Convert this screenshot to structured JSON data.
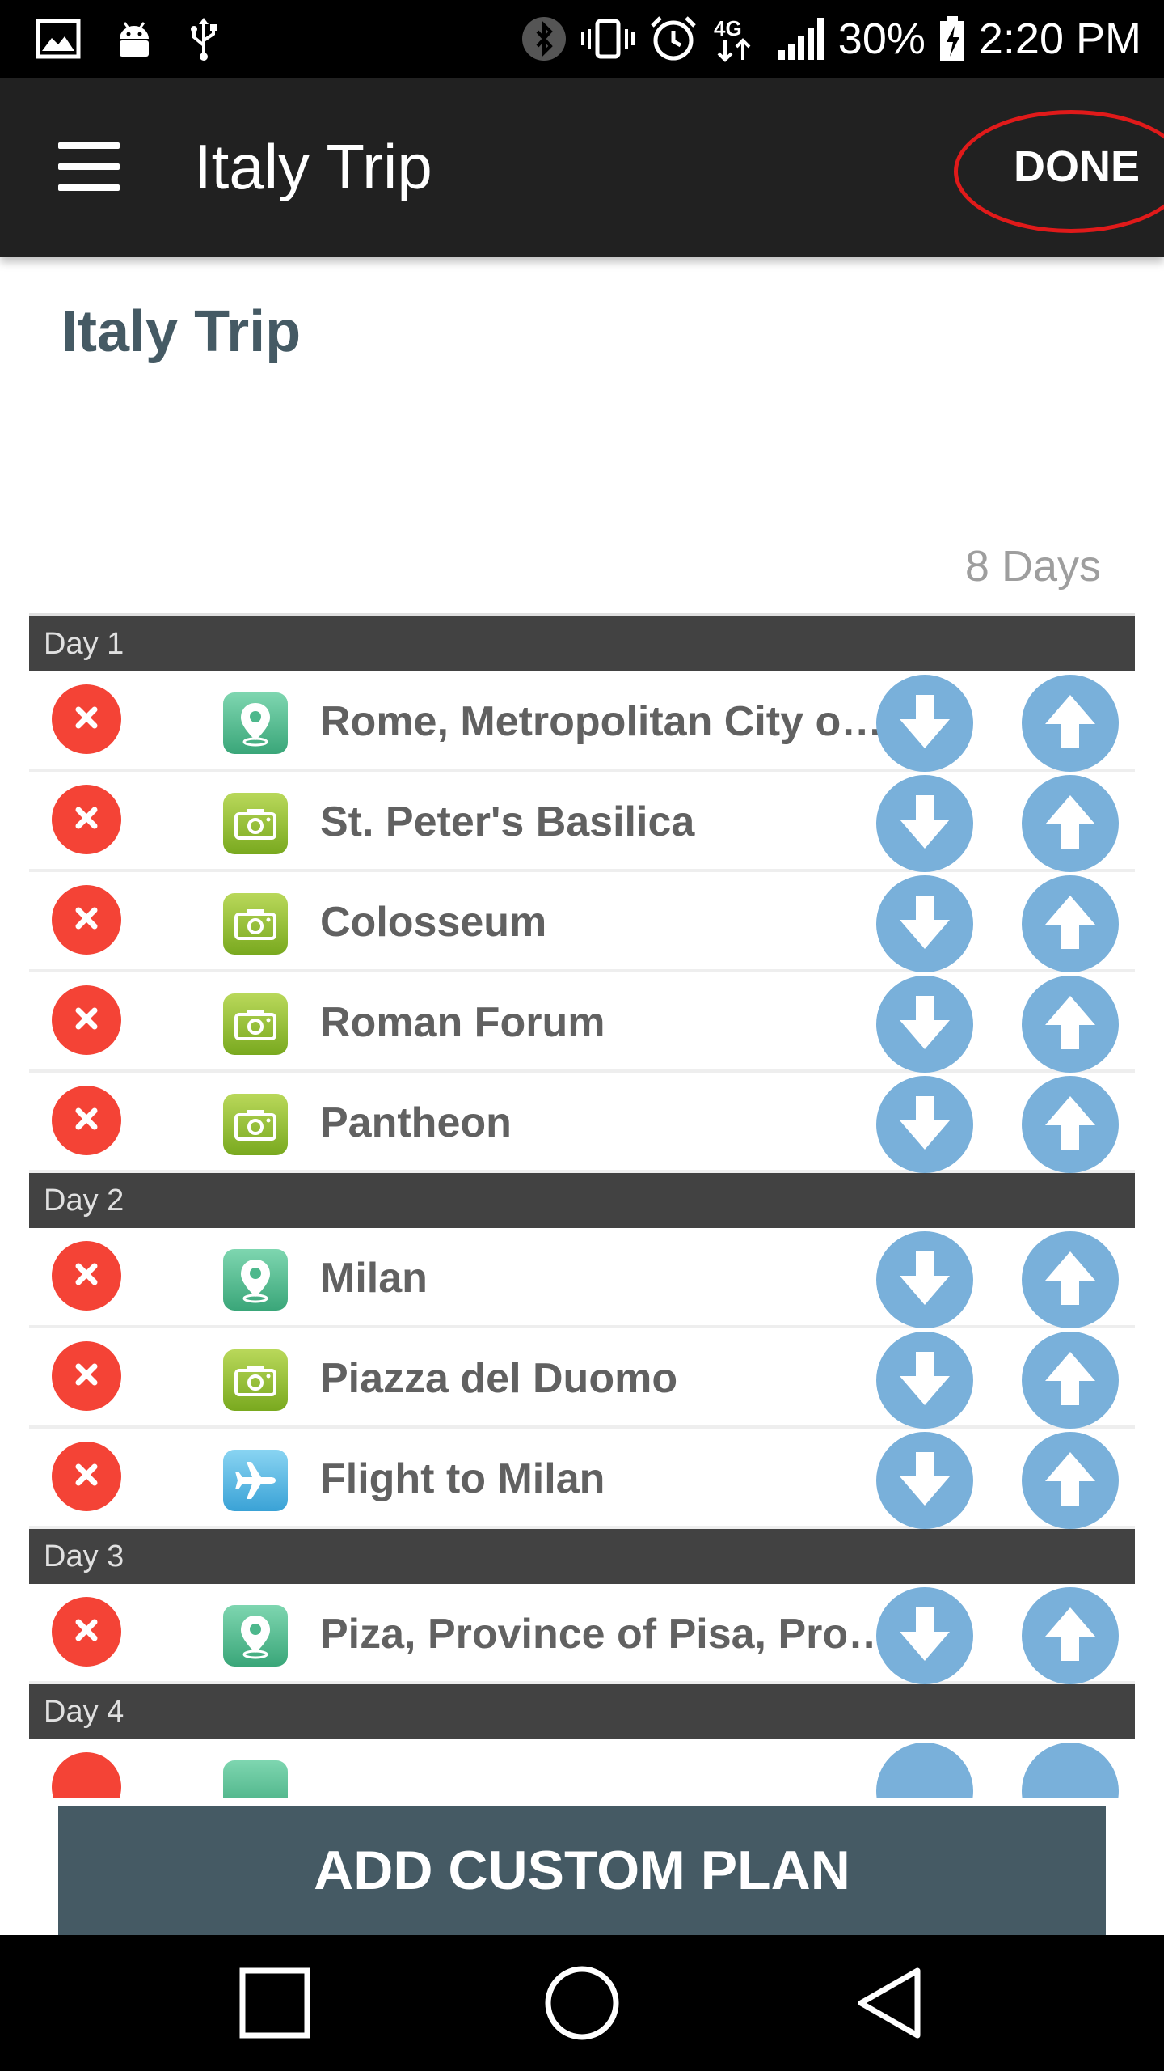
{
  "status_bar": {
    "battery": "30%",
    "time": "2:20 PM",
    "network": "4G",
    "icons": [
      "gallery-icon",
      "android-icon",
      "usb-icon",
      "bluetooth-icon",
      "vibrate-icon",
      "alarm-icon",
      "network-4g-icon",
      "signal-icon",
      "battery-charging-icon"
    ]
  },
  "app_bar": {
    "title": "Italy Trip",
    "done_label": "DONE",
    "menu_icon": "hamburger-menu-icon"
  },
  "trip": {
    "title": "Italy Trip",
    "duration": "8 Days"
  },
  "days": [
    {
      "label": "Day 1",
      "items": [
        {
          "type": "location",
          "name": "Rome, Metropolitan City of Rome, Italy"
        },
        {
          "type": "camera",
          "name": "St. Peter's Basilica"
        },
        {
          "type": "camera",
          "name": "Colosseum"
        },
        {
          "type": "camera",
          "name": "Roman Forum"
        },
        {
          "type": "camera",
          "name": "Pantheon"
        }
      ]
    },
    {
      "label": "Day 2",
      "items": [
        {
          "type": "location",
          "name": "Milan"
        },
        {
          "type": "camera",
          "name": "Piazza del Duomo"
        },
        {
          "type": "flight",
          "name": "Flight to Milan"
        }
      ]
    },
    {
      "label": "Day 3",
      "items": [
        {
          "type": "location",
          "name": "Piza, Province of Pisa, Province of Pisa, Italy"
        }
      ]
    },
    {
      "label": "Day 4",
      "items": []
    }
  ],
  "add_plan_label": "ADD CUSTOM PLAN",
  "colors": {
    "status_bar": "#000000",
    "app_bar": "#212121",
    "delete": "#f44336",
    "move": "#79b0da",
    "day_header": "#424242",
    "add_plan": "#455a64",
    "done_highlight": "#e01a1a"
  }
}
